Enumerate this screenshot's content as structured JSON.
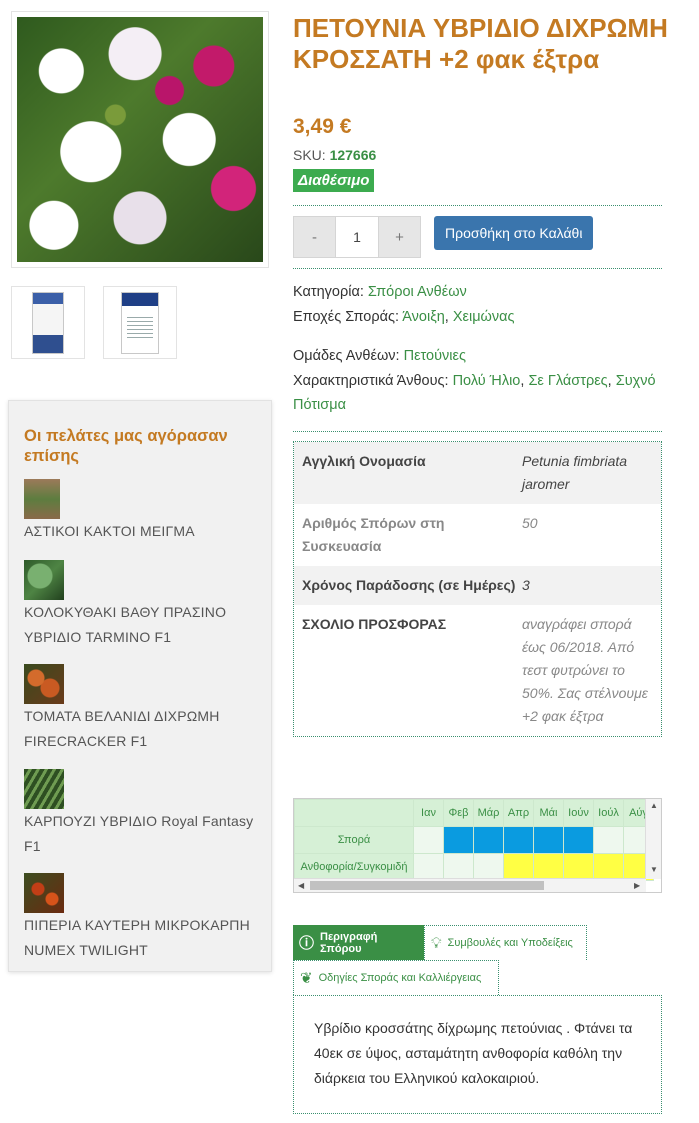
{
  "product": {
    "title": "ΠΕΤΟΥΝΙΑ ΥΒΡΙΔΙΟ ΔΙΧΡΩΜΗ ΚΡΟΣΣΑΤΗ +2 φακ έξτρα",
    "price": "3,49 €",
    "sku_label": "SKU:",
    "sku_value": "127666",
    "availability": "Διαθέσιμο",
    "qty_minus": "-",
    "qty_value": "1",
    "qty_plus": "+",
    "add_to_cart": "Προσθήκη στο Καλάθι"
  },
  "meta": {
    "category_label": "Κατηγορία:",
    "category": "Σπόροι Ανθέων",
    "seasons_label": "Εποχές Σποράς:",
    "season1": "Άνοιξη",
    "season2": "Χειμώνας",
    "groups_label": "Ομάδες Ανθέων:",
    "group1": "Πετούνιες",
    "features_label": "Χαρακτηριστικά Άνθους:",
    "feature1": "Πολύ Ήλιο",
    "feature2": "Σε Γλάστρες",
    "feature3": "Συχνό Πότισμα"
  },
  "specs": [
    {
      "key": "Αγγλική Ονομασία",
      "value": "Petunia fimbriata jaromer"
    },
    {
      "key": "Αριθμός Σπόρων στη Συσκευασία",
      "value": "50"
    },
    {
      "key": "Χρόνος Παράδοσης (σε Ημέρες)",
      "value": "3"
    },
    {
      "key": "ΣΧΟΛΙΟ ΠΡΟΣΦΟΡΑΣ",
      "value": "αναγράφει σπορά έως 06/2018. Από τεστ φυτρώνει το 50%. Σας στέλνουμε +2 φακ έξτρα"
    }
  ],
  "calendar": {
    "months": [
      "Ιαν",
      "Φεβ",
      "Μάρ",
      "Απρ",
      "Μάι",
      "Ιούν",
      "Ιούλ",
      "Αύγ"
    ],
    "row1_label": "Σπορά",
    "row2_label": "Ανθοφορία/Συγκομιδή",
    "colors": {
      "sowing": "#0a9be0",
      "bloom": "#ffff44"
    }
  },
  "tabs": {
    "tab1": "Περιγραφή Σπόρου",
    "tab2": "Συμβουλές και Υποδείξεις",
    "tab3": "Οδηγίες Σποράς και Καλλιέργειας"
  },
  "description": "Υβρίδιο κροσσάτης δίχρωμης πετούνιας . Φτάνει τα 40εκ σε ύψος, ασταμάτητη ανθοφορία καθόλη την διάρκεια του Ελληνικού καλοκαιριού.",
  "sidebar": {
    "title": "Οι πελάτες μας αγόρασαν επίσης",
    "items": [
      {
        "name": "ΑΣΤΙΚΟΙ ΚΑΚΤΟΙ ΜΕΙΓΜΑ"
      },
      {
        "name": "ΚΟΛΟΚΥΘΑΚΙ ΒΑΘΥ ΠΡΑΣΙΝΟ ΥΒΡΙΔΙΟ TARMINO F1"
      },
      {
        "name": "ΤΟΜΑΤΑ ΒΕΛΑΝΙΔΙ ΔΙΧΡΩΜΗ FIRECRACKER F1"
      },
      {
        "name": "ΚΑΡΠΟΥΖΙ ΥΒΡΙΔΙΟ Royal Fantasy F1"
      },
      {
        "name": "ΠΙΠΕΡΙΑ ΚΑΥΤΕΡΗ ΜΙΚΡΟΚΑΡΠΗ NUMEX TWILIGHT"
      }
    ]
  },
  "accent_color": "#c47a22",
  "link_color": "#3a8f45"
}
